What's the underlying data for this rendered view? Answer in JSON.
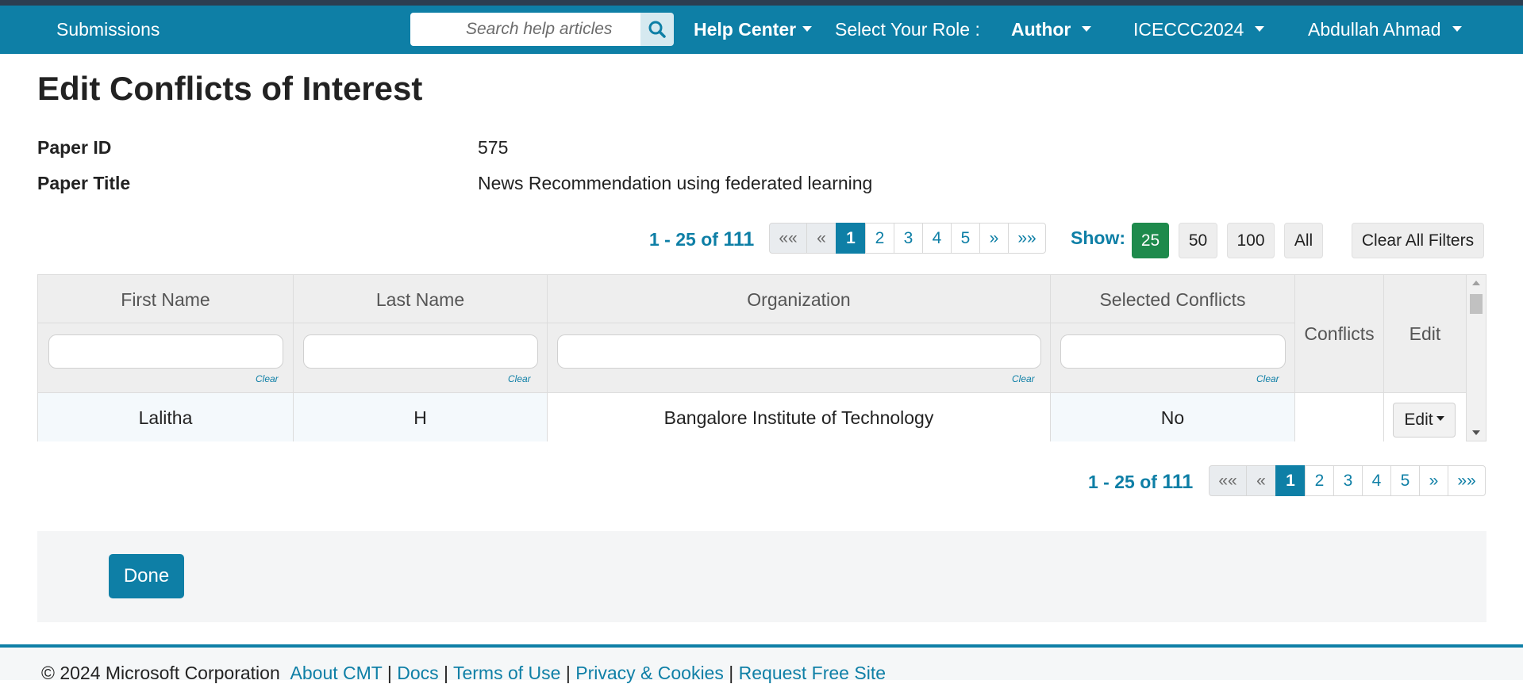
{
  "nav": {
    "submissions": "Submissions",
    "search_placeholder": "Search help articles",
    "help_center": "Help Center",
    "role_label": "Select Your Role :",
    "role_value": "Author",
    "conference": "ICECCC2024",
    "user": "Abdullah Ahmad"
  },
  "page": {
    "title": "Edit Conflicts of Interest",
    "paper_id_label": "Paper ID",
    "paper_id": "575",
    "paper_title_label": "Paper Title",
    "paper_title": "News Recommendation using federated learning"
  },
  "pagination": {
    "range": "1 - 25 of ",
    "total": "111",
    "first": "««",
    "prev": "«",
    "pages": [
      "1",
      "2",
      "3",
      "4",
      "5"
    ],
    "active_page": "1",
    "next": "»",
    "last": "»»"
  },
  "show": {
    "label": "Show:",
    "options": [
      "25",
      "50",
      "100",
      "All"
    ],
    "selected": "25",
    "clear_filters": "Clear All Filters"
  },
  "table": {
    "columns": [
      "First Name",
      "Last Name",
      "Organization",
      "Selected Conflicts",
      "Conflicts",
      "Edit"
    ],
    "clear_label": "Clear",
    "rows": [
      {
        "first_name": "Lalitha",
        "last_name": "H",
        "organization": "Bangalore Institute of Technology",
        "selected_conflicts": "No",
        "conflicts": "",
        "edit": "Edit"
      }
    ]
  },
  "done_label": "Done",
  "footer": {
    "copyright": "© 2024 Microsoft Corporation",
    "links": [
      "About CMT",
      "Docs",
      "Terms of Use",
      "Privacy & Cookies",
      "Request Free Site"
    ],
    "separator": "|"
  },
  "colors": {
    "primary": "#0e7fa6",
    "show_active": "#1e8a4c",
    "header_bg": "#eeeeee"
  },
  "icons": {
    "search": "search-icon",
    "caret": "caret-down-icon",
    "scroll_up": "scroll-up-arrow-icon",
    "scroll_down": "scroll-down-arrow-icon"
  }
}
